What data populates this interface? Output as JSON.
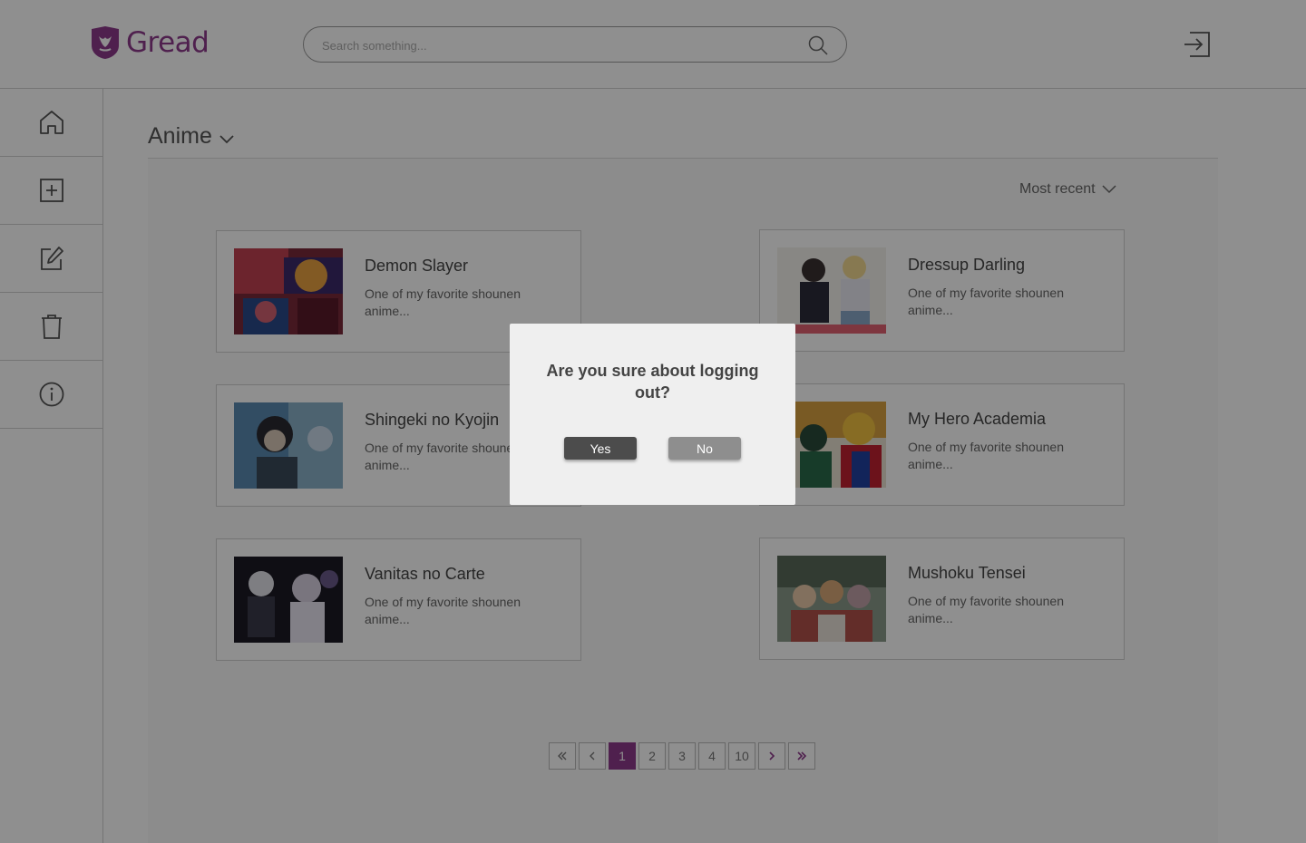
{
  "brand": {
    "name": "Gread",
    "color": "#8e3a8c"
  },
  "search": {
    "placeholder": "Search something..."
  },
  "sidebar": {
    "items": [
      {
        "name": "home",
        "icon": "home-icon"
      },
      {
        "name": "add",
        "icon": "plus-square-icon"
      },
      {
        "name": "edit",
        "icon": "edit-icon"
      },
      {
        "name": "delete",
        "icon": "trash-icon"
      },
      {
        "name": "info",
        "icon": "info-icon"
      }
    ]
  },
  "main": {
    "category": "Anime",
    "sort": "Most recent",
    "cards": [
      {
        "title": "Demon Slayer",
        "description": "One of my favorite shounen anime..."
      },
      {
        "title": "Dressup Darling",
        "description": "One of my favorite shounen anime..."
      },
      {
        "title": "Shingeki no Kyojin",
        "description": "One of my favorite shounen anime..."
      },
      {
        "title": "My Hero Academia",
        "description": "One of my favorite shounen anime..."
      },
      {
        "title": "Vanitas no Carte",
        "description": "One of my favorite shounen anime..."
      },
      {
        "title": "Mushoku Tensei",
        "description": "One of my favorite shounen anime..."
      }
    ]
  },
  "pagination": {
    "pages": [
      "1",
      "2",
      "3",
      "4",
      "10"
    ],
    "current": "1"
  },
  "modal": {
    "message": "Are you sure about logging out?",
    "yes_label": "Yes",
    "no_label": "No"
  }
}
